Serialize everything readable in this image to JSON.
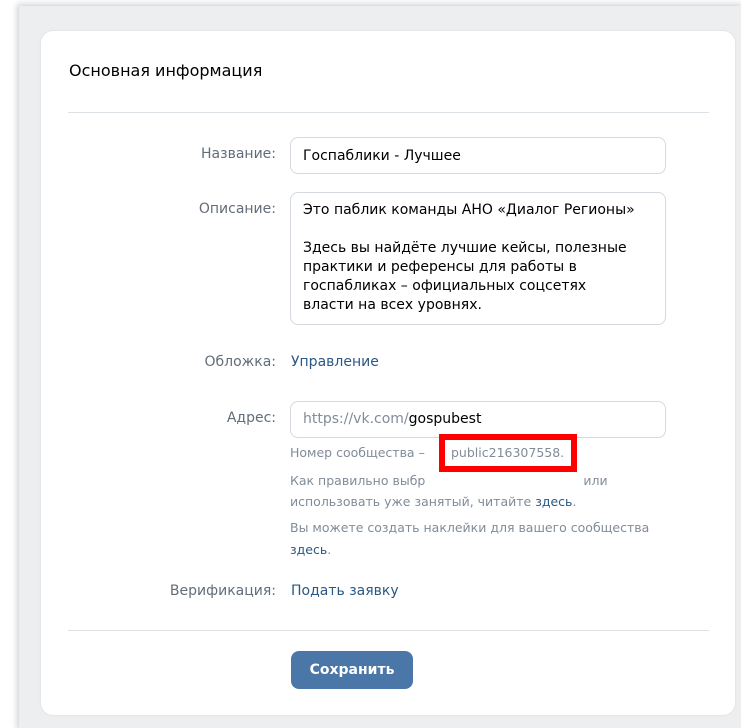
{
  "section": {
    "title": "Основная информация"
  },
  "fields": {
    "name": {
      "label": "Название:",
      "value": "Госпаблики - Лучшее"
    },
    "description": {
      "label": "Описание:",
      "value": "Это паблик команды АНО «Диалог Регионы»\n\nЗдесь вы найдёте лучшие кейсы, полезные\nпрактики и референсы для работы в\nгоспабликах – официальных соцсетях\nвласти на всех уровнях."
    },
    "cover": {
      "label": "Обложка:",
      "link": "Управление"
    },
    "address": {
      "label": "Адрес:",
      "prefix": "https://vk.com/",
      "value": "gospubest",
      "community_number_label": "Номер сообщества –",
      "community_number": "public216307558.",
      "hint_part1": "Как правильно выбр",
      "hint_part2": "или",
      "hint_part3": "использовать уже занятый, читайте",
      "hint_link": "здесь",
      "hint_end": ".",
      "stickers_text": "Вы можете создать наклейки для вашего сообщества",
      "stickers_link": "здесь",
      "stickers_end": "."
    },
    "verification": {
      "label": "Верификация:",
      "link": "Подать заявку"
    }
  },
  "actions": {
    "save_label": "Сохранить"
  },
  "colors": {
    "accent": "#4a76a8",
    "link": "#2a5885",
    "highlight": "#ff0000"
  }
}
